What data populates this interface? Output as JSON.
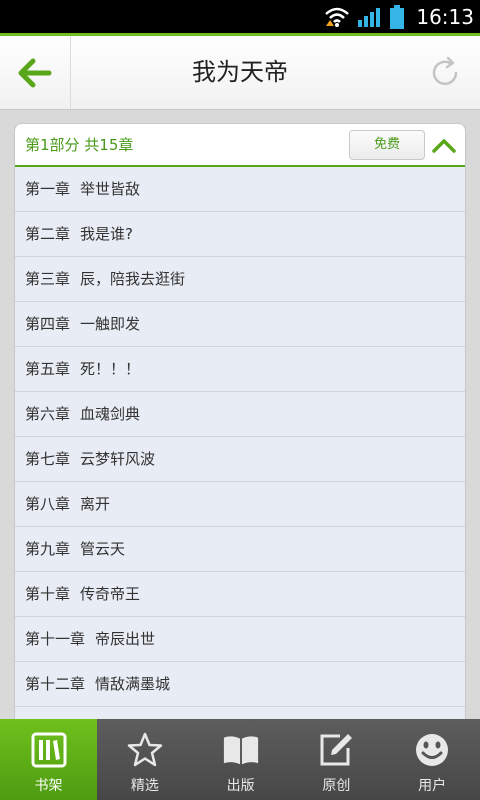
{
  "status": {
    "time": "16:13"
  },
  "header": {
    "title": "我为天帝"
  },
  "section": {
    "title": "第1部分  共15章",
    "free_label": "免费",
    "chapters": [
      {
        "num": "第一章",
        "name": "举世皆敌"
      },
      {
        "num": "第二章",
        "name": "我是谁?"
      },
      {
        "num": "第三章",
        "name": "辰，陪我去逛街"
      },
      {
        "num": "第四章",
        "name": "一触即发"
      },
      {
        "num": "第五章",
        "name": "死！！！"
      },
      {
        "num": "第六章",
        "name": "血魂剑典"
      },
      {
        "num": "第七章",
        "name": "云梦轩风波"
      },
      {
        "num": "第八章",
        "name": "离开"
      },
      {
        "num": "第九章",
        "name": "管云天"
      },
      {
        "num": "第十章",
        "name": "传奇帝王"
      },
      {
        "num": "第十一章",
        "name": "帝辰出世"
      },
      {
        "num": "第十二章",
        "name": "情敌满墨城"
      },
      {
        "num": "",
        "name": ""
      }
    ]
  },
  "nav": {
    "items": [
      {
        "label": "书架",
        "icon": "bookshelf-icon"
      },
      {
        "label": "精选",
        "icon": "star-icon"
      },
      {
        "label": "出版",
        "icon": "open-book-icon"
      },
      {
        "label": "原创",
        "icon": "edit-icon"
      },
      {
        "label": "用户",
        "icon": "smiley-icon"
      }
    ]
  },
  "colors": {
    "accent": "#5aa61b",
    "nav_bg": "#4f4f4f"
  }
}
